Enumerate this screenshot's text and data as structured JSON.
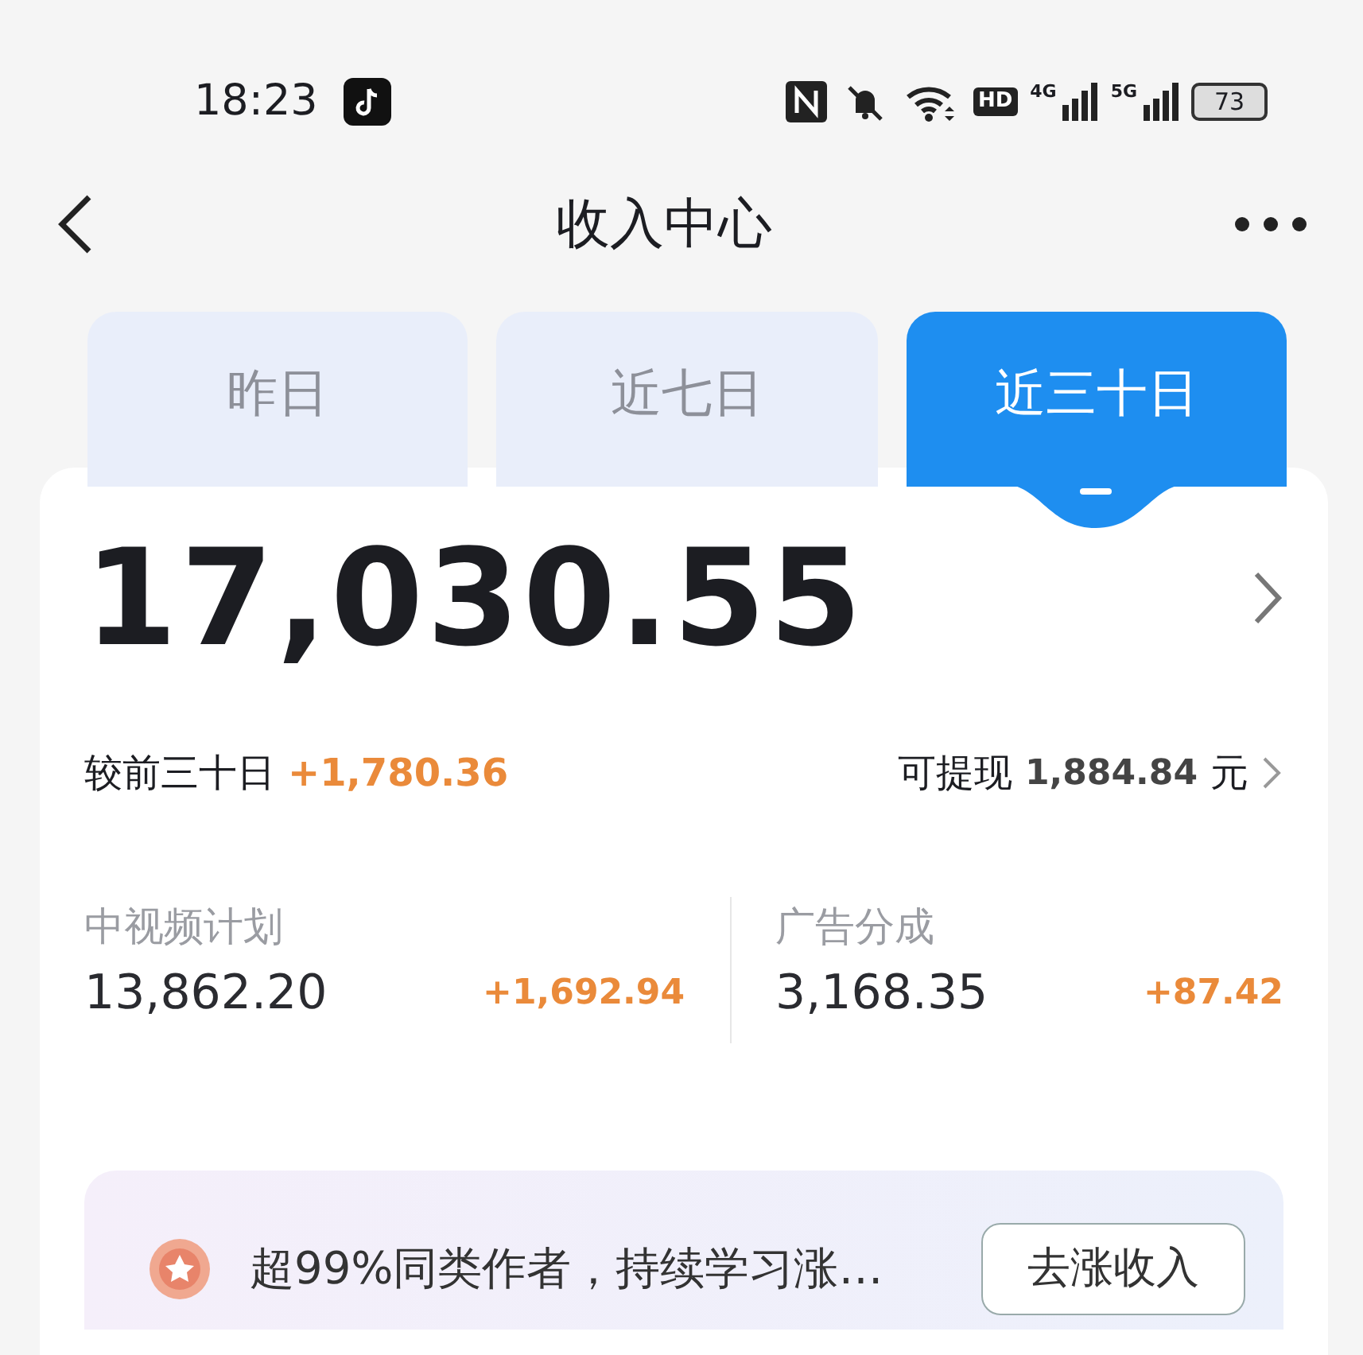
{
  "status_bar": {
    "time": "18:23",
    "hd": "HD",
    "signals": [
      "4G",
      "5G"
    ],
    "battery": "73"
  },
  "header": {
    "title": "收入中心"
  },
  "tabs": [
    {
      "label": "昨日",
      "selected": false
    },
    {
      "label": "近七日",
      "selected": false
    },
    {
      "label": "近三十日",
      "selected": true
    }
  ],
  "summary": {
    "total": "17,030.55",
    "compare_label": "较前三十日",
    "compare_value": "+1,780.36",
    "withdraw_label": "可提现",
    "withdraw_value": "1,884.84",
    "withdraw_unit": "元"
  },
  "breakdown": [
    {
      "label": "中视频计划",
      "value": "13,862.20",
      "change": "+1,692.94"
    },
    {
      "label": "广告分成",
      "value": "3,168.35",
      "change": "+87.42"
    }
  ],
  "banner": {
    "text": "超99%同类作者，持续学习涨…",
    "button": "去涨收入"
  }
}
